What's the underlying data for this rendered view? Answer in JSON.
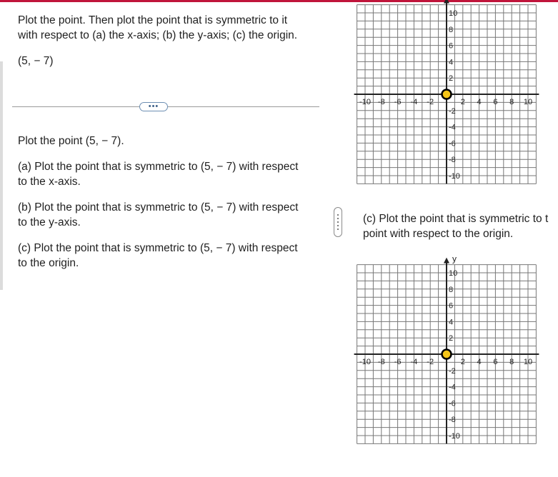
{
  "question": {
    "prompt": "Plot the point. Then plot the point that is symmetric to it with respect to (a) the x-axis; (b) the y-axis; (c) the origin.",
    "prompt_line1": "Plot the point. Then plot the point that is symmetric to it",
    "prompt_line2": "with respect to (a) the x-axis; (b) the y-axis; (c) the origin.",
    "point": "(5, − 7)",
    "more_button": "•••"
  },
  "parts": {
    "plot_point": "Plot the point (5, − 7).",
    "a_line1": "(a) Plot the point that is symmetric to (5, − 7) with respect",
    "a_line2": "to the x-axis.",
    "b_line1": "(b) Plot the point that is symmetric to (5, − 7) with respect",
    "b_line2": "to the y-axis.",
    "c_line1": "(c) Plot the point that is symmetric to (5, − 7) with respect",
    "c_line2": "to the origin."
  },
  "right_panel": {
    "c_line1": "(c) Plot the point that is symmetric to t",
    "c_line2": "point with respect to the origin."
  },
  "graphs": [
    {
      "x_tick_labels": [
        "-10",
        "-8",
        "-6",
        "-4",
        "-2",
        "2",
        "4",
        "6",
        "8",
        "10"
      ],
      "y_tick_labels": [
        "10",
        "8",
        "6",
        "4",
        "2",
        "-2",
        "-4",
        "-6",
        "-8",
        "-10"
      ],
      "marker": [
        0,
        0
      ],
      "y_axis_label": ""
    },
    {
      "x_tick_labels": [
        "-10",
        "-8",
        "-6",
        "-4",
        "-2",
        "2",
        "4",
        "6",
        "8",
        "10"
      ],
      "y_tick_labels": [
        "10",
        "8",
        "6",
        "4",
        "2",
        "-2",
        "-4",
        "-6",
        "-8",
        "-10"
      ],
      "marker": [
        0,
        0
      ],
      "y_axis_label": "y"
    }
  ],
  "colors": {
    "accent": "#c0153b",
    "marker_fill": "#f5c518",
    "marker_stroke": "#000000",
    "grid": "#777777"
  }
}
